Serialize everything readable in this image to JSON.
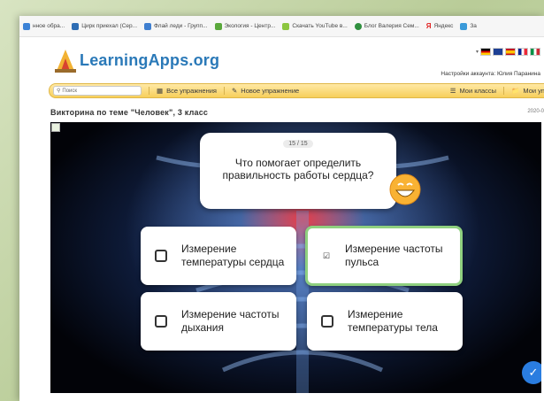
{
  "bookmarks": [
    {
      "label": "нное обра...",
      "color": "#3b82d6"
    },
    {
      "label": "Цирк приехал (Сер...",
      "color": "#2e6db4"
    },
    {
      "label": "Флай леди - Групп...",
      "color": "#3f7fd0"
    },
    {
      "label": "Экология - Центр...",
      "color": "#5aa83c"
    },
    {
      "label": "Скачать YouTube в...",
      "color": "#8cc63f"
    },
    {
      "label": "Блог Валерия Сем...",
      "color": "#2f8f3e"
    },
    {
      "label": "Яндекс",
      "color": "#e02020"
    },
    {
      "label": "За",
      "color": "#3a9ad9"
    }
  ],
  "site": {
    "logo_text": "LearningApps.org",
    "account": "Настройки аккаунта: Юлия Паранина"
  },
  "nav": {
    "search_placeholder": "Поиск",
    "all_exercises": "Все упражнения",
    "new_exercise": "Новое упражнение",
    "my_classes": "Мои классы",
    "my_exercises": "Мои упражнени"
  },
  "page": {
    "title": "Викторина по теме \"Человек\", 3 класс",
    "date": "2020-0"
  },
  "quiz": {
    "counter": "15 / 15",
    "question": "Что помогает определить правильность работы сердца?",
    "answers": [
      {
        "text": "Измерение температуры сердца",
        "selected": false
      },
      {
        "text": "Измерение частоты пульса",
        "selected": true
      },
      {
        "text": "Измерение частоты дыхания",
        "selected": false
      },
      {
        "text": "Измерение температуры тела",
        "selected": false
      }
    ]
  },
  "colors": {
    "accent": "#2a79b8",
    "nav_bar": "#f7cf5b",
    "selected_border": "#8fd07f",
    "help_button": "#2a7de0"
  }
}
